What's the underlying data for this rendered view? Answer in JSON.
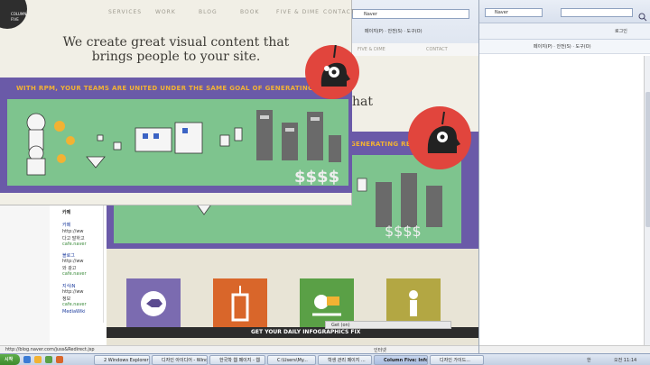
{
  "colors": {
    "cream": "#f1efe6",
    "purple": "#6a5aa8",
    "orange_text": "#f2b233",
    "green": "#7ec48e",
    "red_circle": "#e1453d",
    "tile_purple": "#7b6bb0",
    "tile_orange": "#d9662a",
    "tile_green": "#5aa046",
    "tile_olive": "#b3a743"
  },
  "front": {
    "logo_line1": "COLUMN",
    "logo_line2": "FIVE",
    "nav": [
      "SERVICES",
      "WORK",
      "BLOG",
      "BOOK",
      "FIVE & DIME",
      "CONTACT"
    ],
    "hero_line1": "We create great visual content that",
    "hero_line2": "brings people to your site.",
    "banner_text": "WITH RPM, YOUR TEAMS ARE UNITED UNDER THE SAME GOAL OF GENERATING REV"
  },
  "mid": {
    "address": "Naver",
    "tab": "Naver",
    "cmd": "페이지(P) · 안전(S) · 도구(O)",
    "nav_partial": [
      "K",
      "FIVE & DIME",
      "CONTACT"
    ],
    "heading_partial": "hat",
    "banner_partial": "GENERATING REV",
    "status": "Get (on)",
    "zone": "인터넷"
  },
  "right": {
    "address": "Naver",
    "tab": "Naver",
    "cmd": "페이지(P) · 안전(S) · 도구(O)",
    "login": "로그인"
  },
  "left_sidebar": {
    "links": [
      "카페",
      "블로그",
      "지식iN"
    ],
    "items": [
      "http://ww",
      "다고 말하고",
      "cafe.naver",
      "블로그 그림",
      "http://ww",
      "와 광고",
      "cafe.naver",
      "지식iN 그",
      "http://ww",
      "정보",
      "cafe.naver",
      "MediaWiki",
      "Med:www",
      "cafe.naver"
    ]
  },
  "footer_banner": "GET YOUR DAILY INFOGRAPHICS FIX",
  "status_url": "http://blog.naver.com/juss&Redirect.jsp",
  "taskbar": {
    "start": "시작",
    "items": [
      "2 Windows Explorer",
      "디자인 아이디어 - Windo",
      "한국학 웹 페이지 - 웹",
      "C:\\Users\\My...",
      "학생 관리 페이지 ...",
      "Column Five: Info...",
      "디자인 가이드..."
    ],
    "clock": "오전 11:14",
    "lang": "한"
  }
}
